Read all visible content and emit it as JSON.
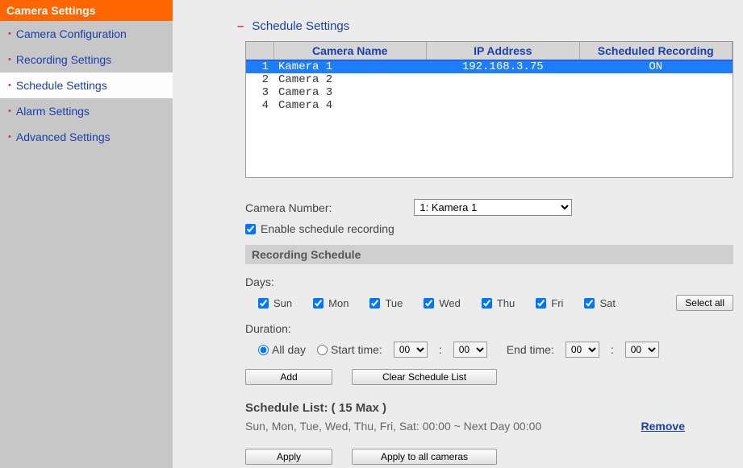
{
  "sidebar": {
    "title": "Camera Settings",
    "items": [
      {
        "label": "Camera Configuration"
      },
      {
        "label": "Recording Settings"
      },
      {
        "label": "Schedule Settings"
      },
      {
        "label": "Alarm Settings"
      },
      {
        "label": "Advanced Settings"
      }
    ],
    "activeIndex": 2
  },
  "section": {
    "title": "Schedule Settings"
  },
  "table": {
    "columns": {
      "name": "Camera Name",
      "ip": "IP Address",
      "sched": "Scheduled Recording"
    },
    "rows": [
      {
        "n": "1",
        "name": "Kamera 1",
        "ip": "192.168.3.75",
        "sched": "ON",
        "selected": true
      },
      {
        "n": "2",
        "name": "Camera 2",
        "ip": "",
        "sched": "",
        "selected": false
      },
      {
        "n": "3",
        "name": "Camera 3",
        "ip": "",
        "sched": "",
        "selected": false
      },
      {
        "n": "4",
        "name": "Camera 4",
        "ip": "",
        "sched": "",
        "selected": false
      }
    ]
  },
  "cameraNumber": {
    "label": "Camera Number:",
    "value": "1: Kamera 1"
  },
  "enableSchedule": {
    "label": "Enable schedule recording",
    "checked": true
  },
  "recordingSchedule": {
    "title": "Recording Schedule",
    "daysLabel": "Days:",
    "days": [
      "Sun",
      "Mon",
      "Tue",
      "Wed",
      "Thu",
      "Fri",
      "Sat"
    ],
    "daysChecked": [
      true,
      true,
      true,
      true,
      true,
      true,
      true
    ],
    "selectAll": "Select all",
    "durationLabel": "Duration:",
    "allDay": "All day",
    "startTime": "Start time:",
    "endTime": "End time:",
    "addBtn": "Add",
    "clearBtn": "Clear Schedule List",
    "timeOptions": [
      "00"
    ],
    "startH": "00",
    "startM": "00",
    "endH": "00",
    "endM": "00",
    "durationSelected": "allday"
  },
  "scheduleList": {
    "title": "Schedule List: ( 15 Max )",
    "entry": "Sun, Mon, Tue, Wed, Thu, Fri, Sat: 00:00 ~ Next Day 00:00",
    "remove": "Remove"
  },
  "applyButtons": {
    "apply": "Apply",
    "applyAll": "Apply to all cameras"
  }
}
